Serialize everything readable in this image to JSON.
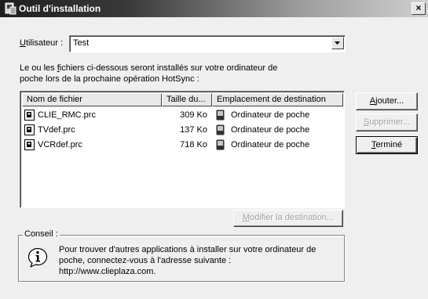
{
  "window": {
    "title": "Outil d'installation",
    "close_label": "×"
  },
  "user": {
    "label_prefix": "U",
    "label_rest": "tilisateur :",
    "value": "Test"
  },
  "intro": {
    "line1_a": "Le ou les ",
    "line1_f": "f",
    "line1_b": "ichiers ci-dessous seront installés sur votre ordinateur de",
    "line2": "poche lors de la prochaine opération HotSync :"
  },
  "table": {
    "columns": [
      "Nom de fichier",
      "Taille du...",
      "Emplacement de destination"
    ],
    "rows": [
      {
        "name": "CLIE_RMC.prc",
        "size": "309 Ko",
        "destination": "Ordinateur de poche"
      },
      {
        "name": "TVdef.prc",
        "size": "137 Ko",
        "destination": "Ordinateur de poche"
      },
      {
        "name": "VCRdef.prc",
        "size": "718 Ko",
        "destination": "Ordinateur de poche"
      }
    ]
  },
  "buttons": {
    "add_u": "A",
    "add_rest": "jouter...",
    "remove_u": "S",
    "remove_rest": "upprimer...",
    "done_u": "T",
    "done_rest": "erminé",
    "modify_u": "M",
    "modify_rest": "odifier la destination..."
  },
  "tip": {
    "title": "Conseil :",
    "line1": "Pour trouver d'autres applications à installer sur votre ordinateur de",
    "line2": "poche, connectez-vous à l'adresse suivante :",
    "line3": "http://www.clieplaza.com."
  },
  "icons": {
    "title": "install-tool-icon",
    "file": "prc-file-icon",
    "device": "handheld-icon",
    "info": "info-icon",
    "dropdown": "dropdown-arrow-icon"
  }
}
